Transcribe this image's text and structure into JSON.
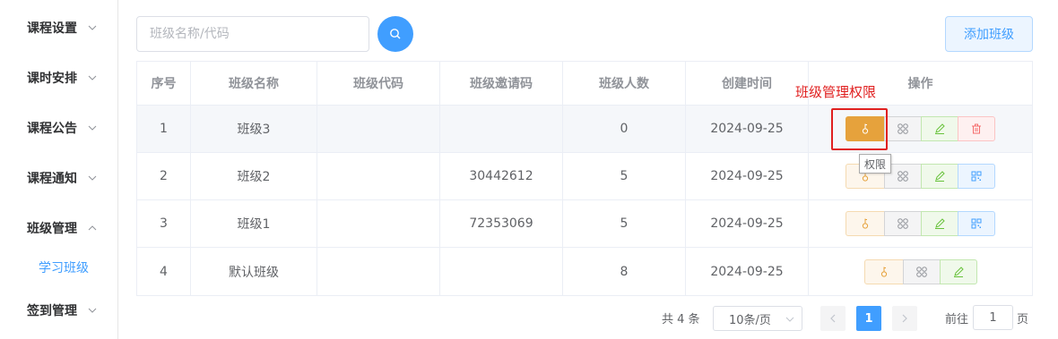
{
  "sidebar": {
    "items": [
      {
        "label": "课程设置"
      },
      {
        "label": "课时安排"
      },
      {
        "label": "课程公告"
      },
      {
        "label": "课程通知"
      },
      {
        "label": "班级管理"
      },
      {
        "label": "签到管理"
      }
    ],
    "sub_item": "学习班级"
  },
  "toolbar": {
    "search_placeholder": "班级名称/代码",
    "add_label": "添加班级"
  },
  "table": {
    "columns": [
      "序号",
      "班级名称",
      "班级代码",
      "班级邀请码",
      "班级人数",
      "创建时间",
      "操作"
    ],
    "rows": [
      {
        "no": "1",
        "name": "班级3",
        "code": "",
        "invite": "",
        "count": "0",
        "created": "2024-09-25"
      },
      {
        "no": "2",
        "name": "班级2",
        "code": "",
        "invite": "30442612",
        "count": "5",
        "created": "2024-09-25"
      },
      {
        "no": "3",
        "name": "班级1",
        "code": "",
        "invite": "72353069",
        "count": "5",
        "created": "2024-09-25"
      },
      {
        "no": "4",
        "name": "默认班级",
        "code": "",
        "invite": "",
        "count": "8",
        "created": "2024-09-25"
      }
    ]
  },
  "annotation": {
    "label": "班级管理权限"
  },
  "tooltip": {
    "label": "权限"
  },
  "pagination": {
    "total": "共 4 条",
    "page_size": "10条/页",
    "current_page": "1",
    "goto_prefix": "前往",
    "goto_value": "1",
    "goto_suffix": "页"
  },
  "colors": {
    "primary": "#409eff",
    "warning": "#e6a23c",
    "success": "#67c23a",
    "danger": "#f56c6c",
    "annotation": "#e02020"
  }
}
